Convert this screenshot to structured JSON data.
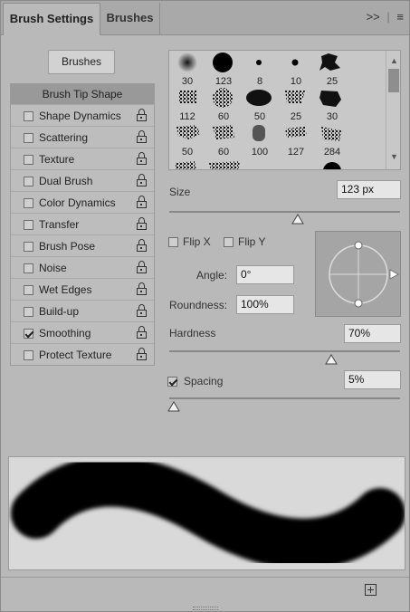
{
  "tabs": {
    "active": "Brush Settings",
    "inactive": "Brushes"
  },
  "brushes_button": "Brushes",
  "options": {
    "header": "Brush Tip Shape",
    "items": [
      {
        "label": "Shape Dynamics",
        "checked": false
      },
      {
        "label": "Scattering",
        "checked": false
      },
      {
        "label": "Texture",
        "checked": false
      },
      {
        "label": "Dual Brush",
        "checked": false
      },
      {
        "label": "Color Dynamics",
        "checked": false
      },
      {
        "label": "Transfer",
        "checked": false
      },
      {
        "label": "Brush Pose",
        "checked": false
      },
      {
        "label": "Noise",
        "checked": false
      },
      {
        "label": "Wet Edges",
        "checked": false
      },
      {
        "label": "Build-up",
        "checked": false
      },
      {
        "label": "Smoothing",
        "checked": true
      },
      {
        "label": "Protect Texture",
        "checked": false
      }
    ]
  },
  "brush_grid": {
    "sizes": [
      "30",
      "123",
      "8",
      "10",
      "25",
      "112",
      "60",
      "50",
      "25",
      "30",
      "50",
      "60",
      "100",
      "127",
      "284"
    ]
  },
  "size": {
    "label": "Size",
    "value": "123 px"
  },
  "flip_x": {
    "label": "Flip X",
    "checked": false
  },
  "flip_y": {
    "label": "Flip Y",
    "checked": false
  },
  "angle": {
    "label": "Angle:",
    "value": "0°"
  },
  "roundness": {
    "label": "Roundness:",
    "value": "100%"
  },
  "hardness": {
    "label": "Hardness",
    "value": "70%"
  },
  "spacing": {
    "label": "Spacing",
    "value": "5%",
    "checked": true
  }
}
